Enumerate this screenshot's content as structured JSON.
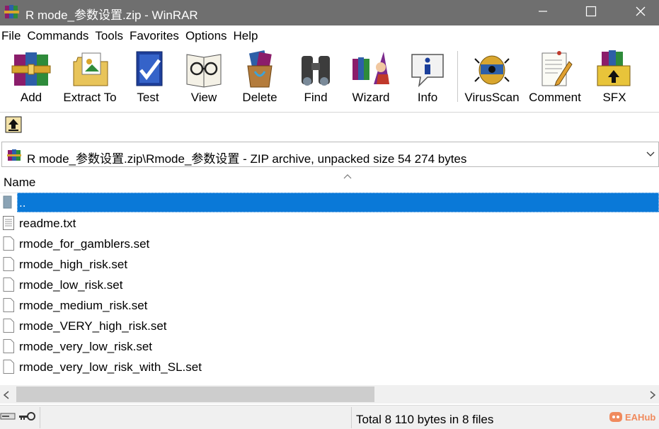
{
  "window": {
    "title": "R mode_参数设置.zip - WinRAR",
    "icon": "winrar-books-icon"
  },
  "menu": [
    "File",
    "Commands",
    "Tools",
    "Favorites",
    "Options",
    "Help"
  ],
  "toolbar": {
    "buttons": [
      {
        "label": "Add",
        "icon": "add-archive-icon"
      },
      {
        "label": "Extract To",
        "icon": "extract-to-icon"
      },
      {
        "label": "Test",
        "icon": "test-icon"
      },
      {
        "label": "View",
        "icon": "view-icon"
      },
      {
        "label": "Delete",
        "icon": "delete-icon"
      },
      {
        "label": "Find",
        "icon": "find-binoculars-icon"
      },
      {
        "label": "Wizard",
        "icon": "wizard-icon"
      },
      {
        "label": "Info",
        "icon": "info-icon"
      },
      {
        "label": "VirusScan",
        "icon": "virus-scan-icon"
      },
      {
        "label": "Comment",
        "icon": "comment-icon"
      },
      {
        "label": "SFX",
        "icon": "sfx-icon"
      }
    ]
  },
  "address": {
    "text": "R mode_参数设置.zip\\Rmode_参数设置 - ZIP archive, unpacked size 54 274 bytes"
  },
  "filelist": {
    "column_name": "Name",
    "rows": [
      {
        "name": "..",
        "type": "parent-folder",
        "selected": true
      },
      {
        "name": "readme.txt",
        "type": "text-file",
        "selected": false
      },
      {
        "name": "rmode_for_gamblers.set",
        "type": "file",
        "selected": false
      },
      {
        "name": "rmode_high_risk.set",
        "type": "file",
        "selected": false
      },
      {
        "name": "rmode_low_risk.set",
        "type": "file",
        "selected": false
      },
      {
        "name": "rmode_medium_risk.set",
        "type": "file",
        "selected": false
      },
      {
        "name": "rmode_VERY_high_risk.set",
        "type": "file",
        "selected": false
      },
      {
        "name": "rmode_very_low_risk.set",
        "type": "file",
        "selected": false
      },
      {
        "name": "rmode_very_low_risk_with_SL.set",
        "type": "file",
        "selected": false
      }
    ]
  },
  "status": {
    "text": "Total 8 110 bytes in 8 files",
    "watermark": "EAHub"
  },
  "colors": {
    "titlebar": "#6f6f6f",
    "selection": "#0a79d8"
  }
}
